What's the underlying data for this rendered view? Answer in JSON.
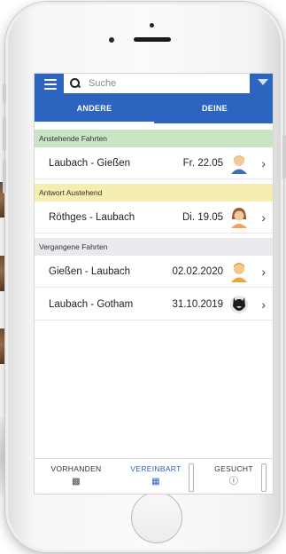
{
  "search": {
    "placeholder": "Suche"
  },
  "tabs": [
    {
      "label": "ANDERE",
      "active": true
    },
    {
      "label": "DEINE",
      "active": false
    }
  ],
  "sections": [
    {
      "title": "Anstehende Fahrten",
      "color": "#c9e5c4",
      "rows": [
        {
          "route": "Laubach - Gießen",
          "date": "Fr. 22.05",
          "avatar": "man-blond-avatar"
        }
      ]
    },
    {
      "title": "Antwort Austehend",
      "color": "#f6edb0",
      "rows": [
        {
          "route": "Röthges - Laubach",
          "date": "Di. 19.05",
          "avatar": "woman-brown-hair-avatar"
        }
      ]
    },
    {
      "title": "Vergangene Fahrten",
      "color": "#eaeaee",
      "rows": [
        {
          "route": "Gießen - Laubach",
          "date": "02.02.2020",
          "avatar": "man-orange-avatar"
        },
        {
          "route": "Laubach - Gotham",
          "date": "31.10.2019",
          "avatar": "batman-avatar"
        }
      ]
    }
  ],
  "bottom_nav": [
    {
      "label": "VORHANDEN",
      "icon": "car-icon",
      "active": false
    },
    {
      "label": "VEREINBART",
      "icon": "calendar-icon",
      "active": true
    },
    {
      "label": "GESUCHT",
      "icon": "help-circle-icon",
      "active": false
    }
  ],
  "colors": {
    "primary": "#2d64bf",
    "upcoming_bg": "#c9e5c4",
    "pending_bg": "#f6edb0",
    "past_bg": "#eaeaee"
  }
}
